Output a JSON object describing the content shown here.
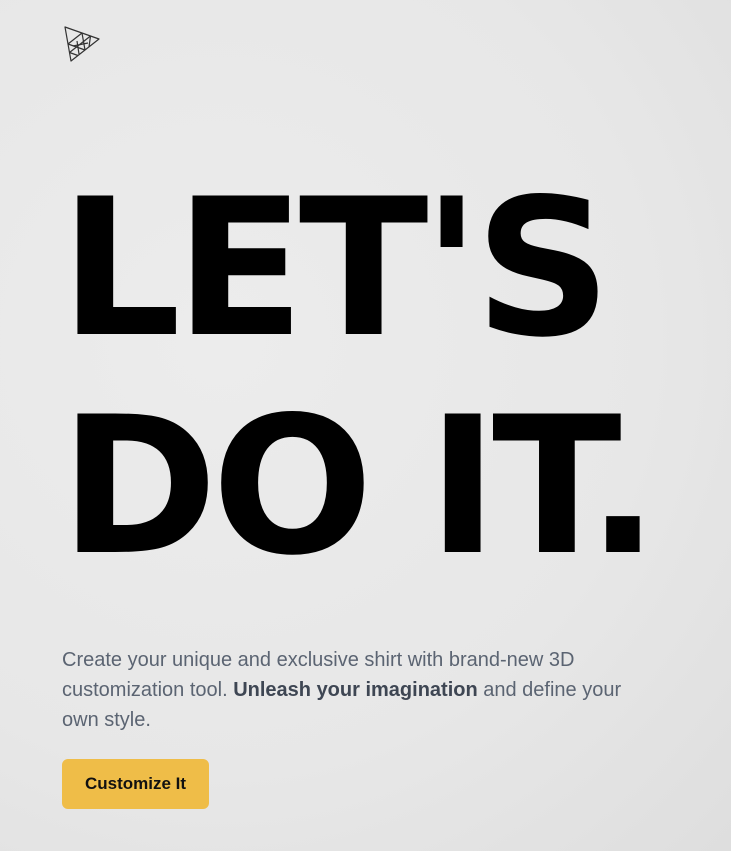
{
  "brand": {
    "logo_icon": "triangle-mesh-icon"
  },
  "hero": {
    "headline_line1": "LET'S",
    "headline_line2": "DO IT.",
    "description_before": "Create your unique and exclusive shirt with brand-new 3D customization tool. ",
    "description_bold": "Unleash your imagination",
    "description_after": " and define your own style.",
    "cta_label": "Customize It"
  },
  "colors": {
    "cta_background": "#efbd48",
    "headline": "#000000",
    "description": "#5b6472"
  }
}
